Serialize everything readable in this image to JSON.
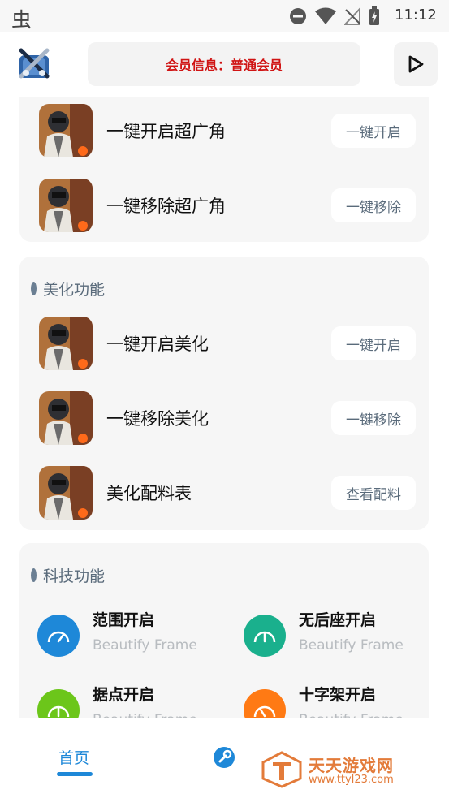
{
  "status_bar": {
    "time": "11:12",
    "left_glyph": "虫"
  },
  "header": {
    "member_info": "会员信息：普通会员"
  },
  "section1": {
    "rows": [
      {
        "label": "一键开启超广角",
        "action": "一键开启"
      },
      {
        "label": "一键移除超广角",
        "action": "一键移除"
      }
    ]
  },
  "section2": {
    "title": "美化功能",
    "rows": [
      {
        "label": "一键开启美化",
        "action": "一键开启"
      },
      {
        "label": "一键移除美化",
        "action": "一键移除"
      },
      {
        "label": "美化配料表",
        "action": "查看配料"
      }
    ]
  },
  "section3": {
    "title": "科技功能",
    "items": [
      {
        "title": "范围开启",
        "subtitle": "Beautify Frame",
        "color": "#1e88d8"
      },
      {
        "title": "无后座开启",
        "subtitle": "Beautify Frame",
        "color": "#1ab08d"
      },
      {
        "title": "据点开启",
        "subtitle": "Beautify Frame",
        "color": "#6cc61a"
      },
      {
        "title": "十字架开启",
        "subtitle": "Beautify Frame",
        "color": "#ff7a14"
      }
    ]
  },
  "bottom_nav": {
    "home_label": "首页",
    "tool_icon": "wrench-icon"
  },
  "watermark": {
    "title": "天天游戏网",
    "url": "www.ttyl23.com"
  },
  "colors": {
    "accent": "#1e88d8",
    "member_text": "#d01414",
    "action_text": "#5a6b7b"
  }
}
